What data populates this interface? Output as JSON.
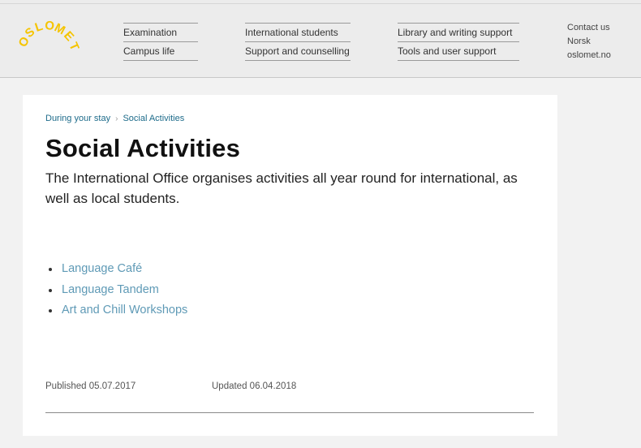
{
  "header": {
    "logo_text": "OSLOMET",
    "nav_columns": [
      [
        "Examination",
        "Campus life"
      ],
      [
        "International students",
        "Support and counselling"
      ],
      [
        "Library and writing support",
        "Tools and user support"
      ]
    ],
    "utility_links": [
      "Contact us",
      "Norsk",
      "oslomet.no"
    ]
  },
  "breadcrumb": {
    "parent": "During your stay",
    "separator": "›",
    "current": "Social Activities"
  },
  "page": {
    "title": "Social Activities",
    "lead": "The International Office organises activities all year round for international, as well as local students.",
    "links": [
      "Language Café",
      "Language Tandem",
      "Art and Chill Workshops"
    ],
    "published": "Published 05.07.2017",
    "updated": "Updated 06.04.2018"
  },
  "colors": {
    "brand": "#f5c400",
    "link": "#5f9ab6",
    "breadcrumb": "#1d6b8a"
  }
}
